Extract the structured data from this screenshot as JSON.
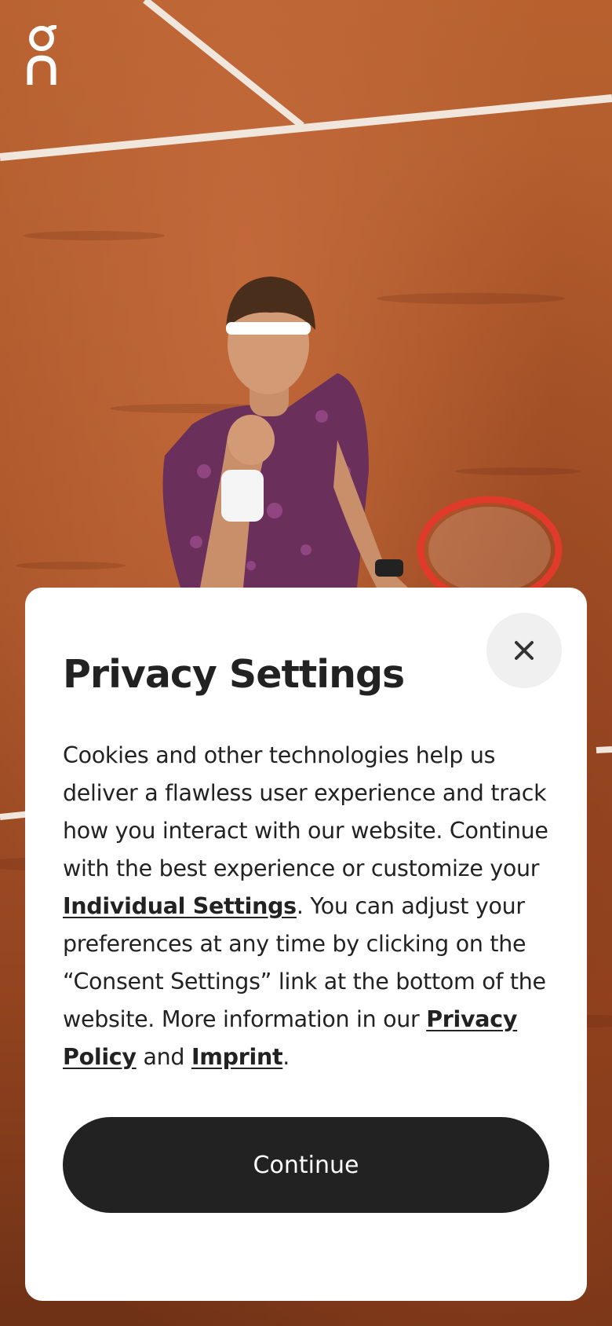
{
  "brand": {
    "logo_icon": "on-logo-icon"
  },
  "hero": {
    "image_icon": "tennis-player-photo"
  },
  "dialog": {
    "title": "Privacy Settings",
    "close_icon": "close-icon",
    "text_1": "Cookies and other technologies help us deliver a flawless user experience and track how you interact with our website. Continue with the best experience or customize your ",
    "link_individual": "Individual Settings",
    "text_2": ". You can adjust your preferences at any time by clicking on the “Consent Settings” link at the bottom of the website. More information in our ",
    "link_privacy": "Privacy Policy",
    "text_3": " and ",
    "link_imprint": "Imprint",
    "text_4": ".",
    "continue_label": "Continue"
  },
  "colors": {
    "button_bg": "#222222",
    "card_bg": "#ffffff",
    "close_bg": "#f0f0f0"
  }
}
